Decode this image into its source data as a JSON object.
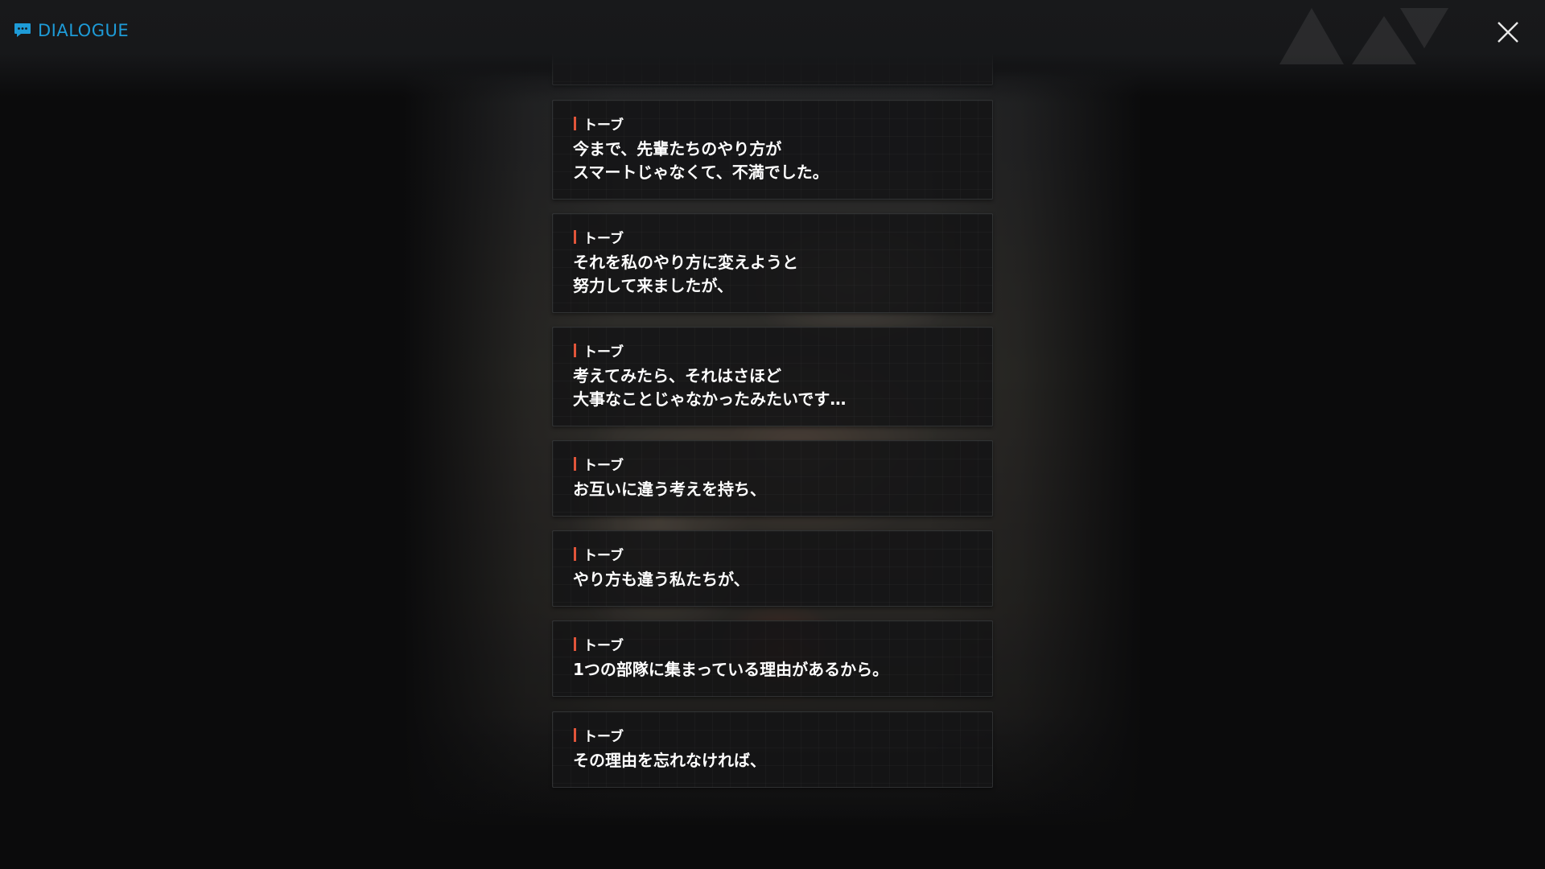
{
  "header": {
    "title": "DIALOGUE",
    "title_icon": "chat-bubble-icon",
    "close_icon": "close-icon",
    "accent_color": "#1e9bd7"
  },
  "dialogue": [
    {
      "speaker": "トーブ",
      "line1": "今まで、先輩たちのやり方が",
      "line2": "スマートじゃなくて、不満でした。"
    },
    {
      "speaker": "トーブ",
      "line1": "それを私のやり方に変えようと",
      "line2": "努力して来ましたが、"
    },
    {
      "speaker": "トーブ",
      "line1": "考えてみたら、それはさほど",
      "line2": "大事なことじゃなかったみたいです…"
    },
    {
      "speaker": "トーブ",
      "line1": "お互いに違う考えを持ち、",
      "line2": ""
    },
    {
      "speaker": "トーブ",
      "line1": "やり方も違う私たちが、",
      "line2": ""
    },
    {
      "speaker": "トーブ",
      "line1": "1つの部隊に集まっている理由があるから。",
      "line2": ""
    },
    {
      "speaker": "トーブ",
      "line1": "その理由を忘れなければ、",
      "line2": ""
    }
  ],
  "speaker_mark_color": "#e2553a"
}
